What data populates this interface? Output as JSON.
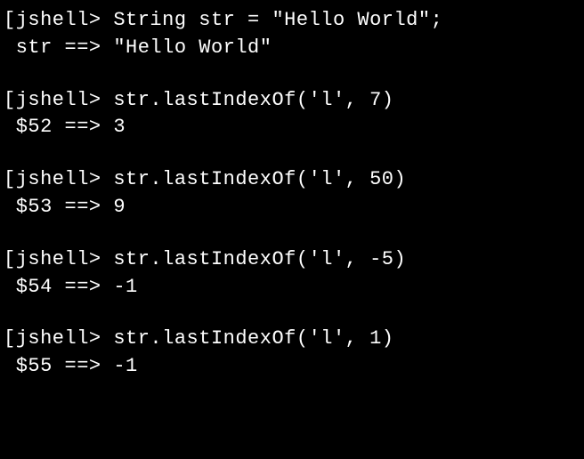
{
  "blocks": [
    {
      "prompt": "jshell>",
      "command": "String str = \"Hello World\";",
      "result_var": "str",
      "result_value": "\"Hello World\""
    },
    {
      "prompt": "jshell>",
      "command": "str.lastIndexOf('l', 7)",
      "result_var": "$52",
      "result_value": "3"
    },
    {
      "prompt": "jshell>",
      "command": "str.lastIndexOf('l', 50)",
      "result_var": "$53",
      "result_value": "9"
    },
    {
      "prompt": "jshell>",
      "command": "str.lastIndexOf('l', -5)",
      "result_var": "$54",
      "result_value": "-1"
    },
    {
      "prompt": "jshell>",
      "command": "str.lastIndexOf('l', 1)",
      "result_var": "$55",
      "result_value": "-1"
    }
  ]
}
